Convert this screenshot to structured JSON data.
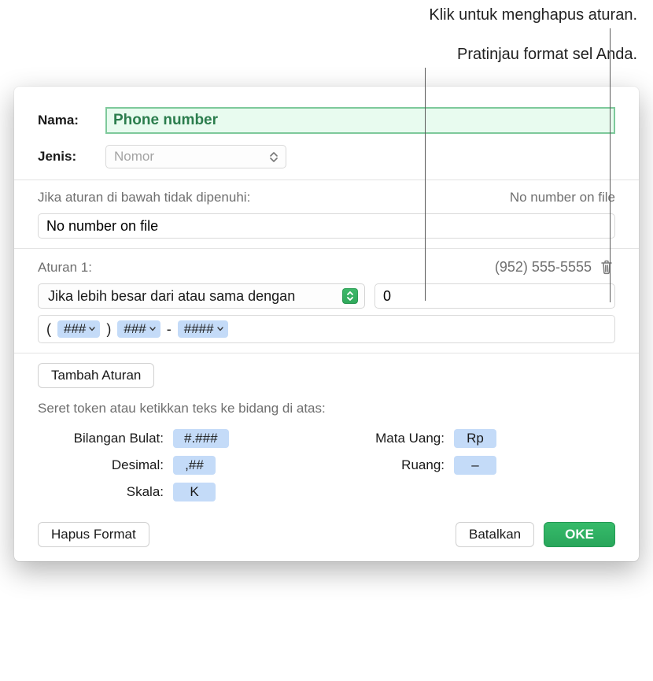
{
  "callouts": {
    "delete": "Klik untuk menghapus aturan.",
    "preview": "Pratinjau format sel Anda."
  },
  "labels": {
    "name": "Nama:",
    "type": "Jenis:",
    "if_not_met": "Jika aturan di bawah tidak dipenuhi:",
    "rule1": "Aturan 1:",
    "drag_help": "Seret token atau ketikkan teks ke bidang di atas:"
  },
  "values": {
    "name": "Phone number",
    "type": "Nomor",
    "fallback_preview": "No number on file",
    "fallback_value": "No number on file",
    "rule1_preview": "(952) 555-5555",
    "condition_text": "Jika lebih besar dari atau sama dengan",
    "condition_value": "0",
    "format_literals": {
      "a": "(",
      "b": ")",
      "c": "-"
    },
    "tokens": {
      "t1": "###",
      "t2": "###",
      "t3": "####"
    }
  },
  "token_palette": {
    "integer_label": "Bilangan Bulat:",
    "integer_token": "#.###",
    "decimal_label": "Desimal:",
    "decimal_token": ",##",
    "scale_label": "Skala:",
    "scale_token": "K",
    "currency_label": "Mata Uang:",
    "currency_token": "Rp",
    "space_label": "Ruang:",
    "space_token": "–"
  },
  "buttons": {
    "add_rule": "Tambah Aturan",
    "delete_format": "Hapus Format",
    "cancel": "Batalkan",
    "ok": "OKE"
  }
}
